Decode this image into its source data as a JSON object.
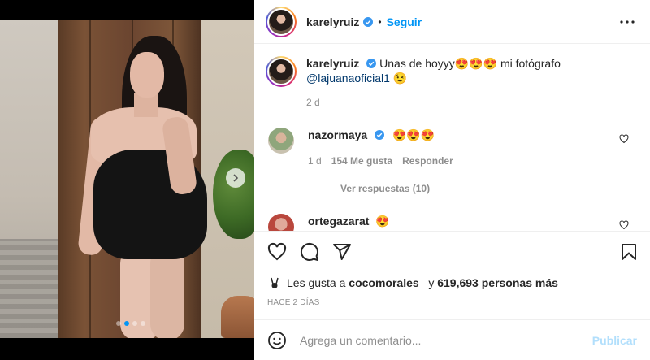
{
  "post": {
    "author": "karelyruiz",
    "follow_label": "Seguir",
    "bullet": "•",
    "caption_text": "Unas de hoyyy😍😍😍 mi fotógrafo",
    "caption_mention": "@lajuanaoficial1",
    "caption_emoji": "😉",
    "caption_age": "2 d",
    "carousel": {
      "slides": 4,
      "active_index": 1
    }
  },
  "comments": [
    {
      "user": "nazormaya",
      "verified": true,
      "text": "😍😍😍",
      "age": "1 d",
      "likes": "154 Me gusta",
      "reply_label": "Responder",
      "view_replies": "Ver respuestas (10)"
    },
    {
      "user": "ortegazarat",
      "verified": false,
      "text": "😍"
    }
  ],
  "likes": {
    "prefix": "Les gusta a",
    "user": "cocomorales_",
    "connector": "y",
    "count": "619,693 personas más"
  },
  "timestamp": "HACE 2 DÍAS",
  "add_comment": {
    "placeholder": "Agrega un comentario...",
    "publish_label": "Publicar"
  },
  "icons": {
    "verified": "verified-badge-icon",
    "more": "more-options-icon",
    "like": "heart-icon",
    "comment": "comment-icon",
    "share": "share-icon",
    "save": "bookmark-icon",
    "emoji": "emoji-icon",
    "next": "chevron-right-icon"
  },
  "colors": {
    "accent": "#0095f6",
    "text": "#262626",
    "muted": "#8e8e8e",
    "publish_disabled": "#b2dffc",
    "verified": "#3897f0"
  }
}
